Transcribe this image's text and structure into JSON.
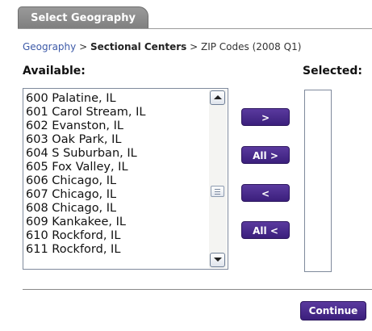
{
  "tab": {
    "label": "Select Geography"
  },
  "breadcrumb": {
    "link": "Geography",
    "sep1": " > ",
    "current": "Sectional Centers",
    "sep2": " > ",
    "rest": "ZIP Codes (2008 Q1)"
  },
  "available_label": "Available:",
  "selected_label": "Selected:",
  "available_items": [
    "600 Palatine, IL",
    "601 Carol Stream, IL",
    "602 Evanston, IL",
    "603 Oak Park, IL",
    "604 S Suburban, IL",
    "605 Fox Valley, IL",
    "606 Chicago, IL",
    "607 Chicago, IL",
    "608 Chicago, IL",
    "609 Kankakee, IL",
    "610 Rockford, IL",
    "611 Rockford, IL"
  ],
  "buttons": {
    "add": ">",
    "add_all": "All >",
    "remove": "<",
    "remove_all": "All <",
    "continue": "Continue"
  },
  "colors": {
    "button": "#4a2d8c",
    "link": "#3d5aa8",
    "tab": "#8a8a8a"
  }
}
